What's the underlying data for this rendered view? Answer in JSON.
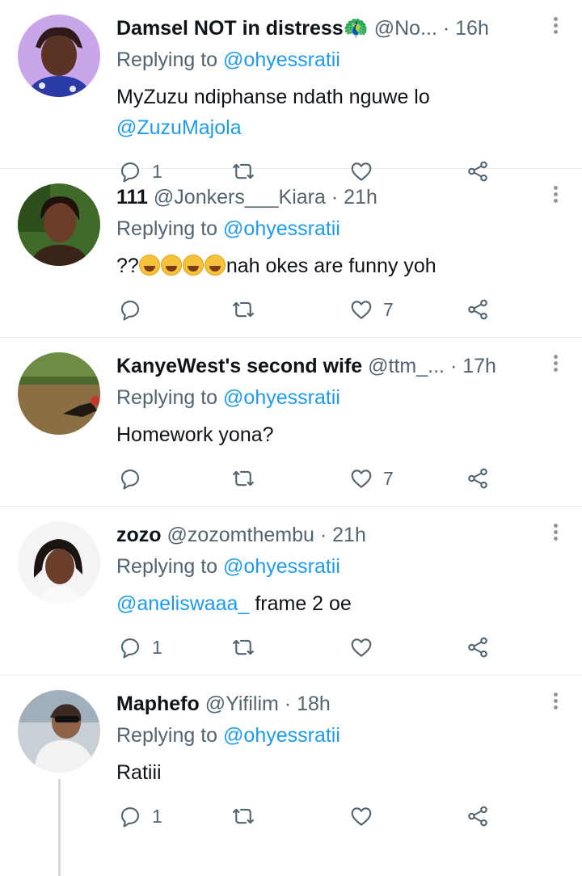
{
  "tweets": [
    {
      "name": "Damsel NOT in distress🦚",
      "handle": "@No...",
      "time": "16h",
      "replying_prefix": "Replying to",
      "replying_to": "@ohyessratii",
      "text_plain": "MyZuzu ndiphanse ndath nguwe lo",
      "text_mention": "@ZuzuMajola",
      "reply_count": "1",
      "retweet_count": "",
      "like_count": "",
      "avatar_colors": [
        "#c9a6ea",
        "#2f1a1a"
      ]
    },
    {
      "name": "111",
      "handle": "@Jonkers___Kiara",
      "time": "21h",
      "replying_prefix": "Replying to",
      "replying_to": "@ohyessratii",
      "text_prefix": "??",
      "text_plain": "nah okes are funny yoh",
      "reply_count": "",
      "retweet_count": "",
      "like_count": "7",
      "avatar_colors": [
        "#3f6a2a",
        "#3a2418"
      ]
    },
    {
      "name": "KanyeWest's second wife",
      "handle": "@ttm_...",
      "time": "17h",
      "replying_prefix": "Replying to",
      "replying_to": "@ohyessratii",
      "text_plain": "Homework yona?",
      "reply_count": "",
      "retweet_count": "",
      "like_count": "7",
      "avatar_colors": [
        "#6e8d44",
        "#8a6f45"
      ]
    },
    {
      "name": "zozo",
      "handle": "@zozomthembu",
      "time": "21h",
      "replying_prefix": "Replying to",
      "replying_to": "@ohyessratii",
      "text_mention": "@aneliswaaa_",
      "text_plain": "frame 2 oe",
      "reply_count": "1",
      "retweet_count": "",
      "like_count": "",
      "avatar_colors": [
        "#f4f4f4",
        "#1c1410"
      ]
    },
    {
      "name": "Maphefo",
      "handle": "@Yifilim",
      "time": "18h",
      "replying_prefix": "Replying to",
      "replying_to": "@ohyessratii",
      "text_plain": "Ratiii",
      "reply_count": "1",
      "retweet_count": "",
      "like_count": "",
      "avatar_colors": [
        "#c8d0d6",
        "#3b2b22"
      ]
    }
  ],
  "icons": {
    "reply": "reply-icon",
    "retweet": "retweet-icon",
    "like": "heart-icon",
    "share": "share-icon",
    "more": "more-icon"
  },
  "colors": {
    "accent": "#1d9bf0",
    "secondary_text": "#536471",
    "icon": "#536471",
    "divider": "#e6ecf0"
  }
}
